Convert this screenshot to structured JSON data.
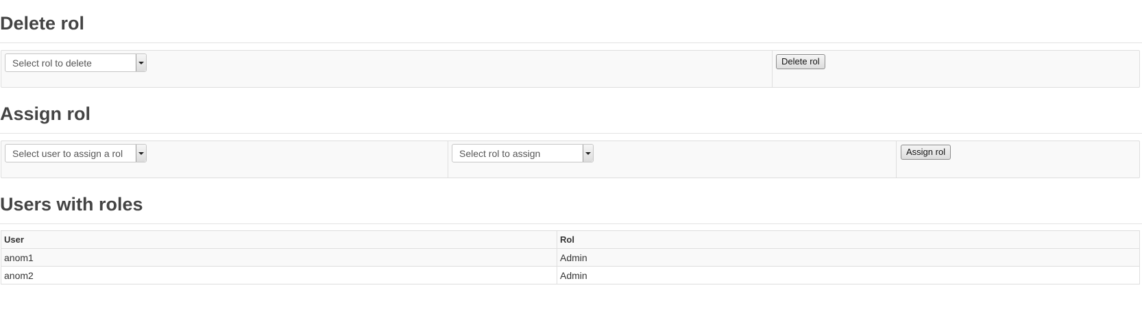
{
  "delete_section": {
    "title": "Delete rol",
    "select_placeholder": "Select rol to delete",
    "button_label": "Delete rol"
  },
  "assign_section": {
    "title": "Assign rol",
    "user_select_placeholder": "Select user to assign a rol",
    "rol_select_placeholder": "Select rol to assign",
    "button_label": "Assign rol"
  },
  "users_section": {
    "title": "Users with roles",
    "columns": [
      "User",
      "Rol"
    ],
    "rows": [
      [
        "anom1",
        "Admin"
      ],
      [
        "anom2",
        "Admin"
      ]
    ]
  }
}
